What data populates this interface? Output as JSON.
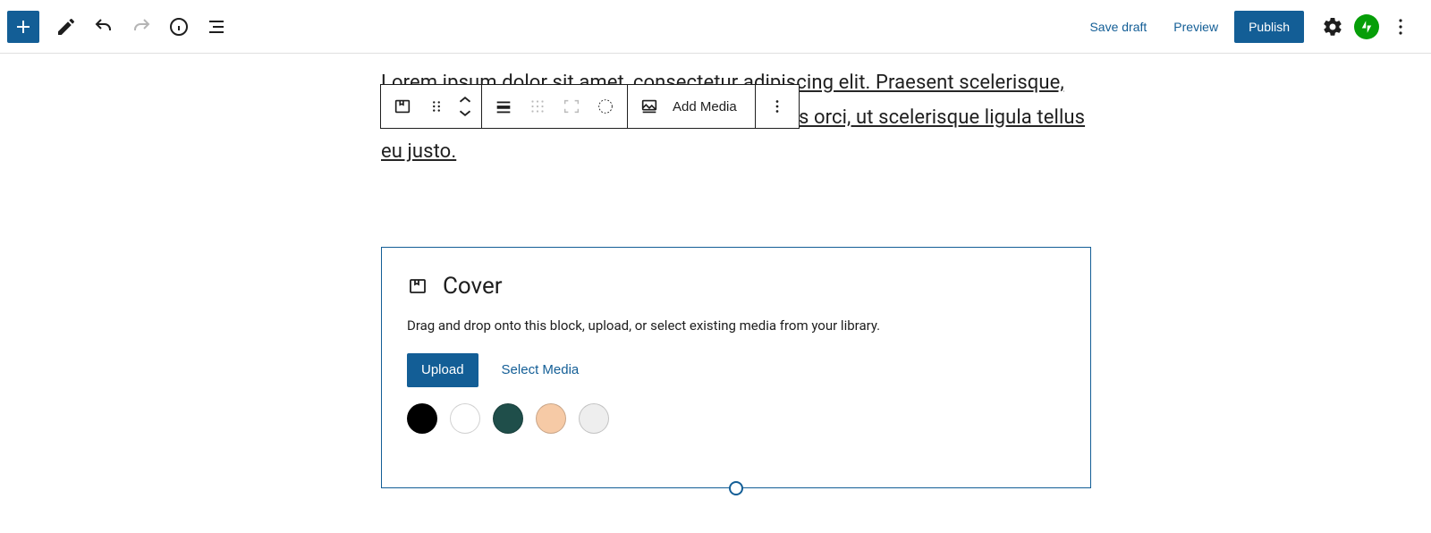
{
  "header": {
    "save_draft": "Save draft",
    "preview": "Preview",
    "publish": "Publish"
  },
  "paragraph": {
    "text": "Lorem ipsum dolor sit amet, consectetur adipiscing elit. Praesent scelerisque, elit venenatis ornare tincidunt, justo urna sagittis orci, ut scelerisque ligula tellus eu justo."
  },
  "block_toolbar": {
    "add_media": "Add Media"
  },
  "cover": {
    "title": "Cover",
    "description": "Drag and drop onto this block, upload, or select existing media from your library.",
    "upload": "Upload",
    "select_media": "Select Media",
    "swatches": [
      "#000000",
      "#ffffff",
      "#1f4e4a",
      "#f6caa6",
      "#eeeeee"
    ]
  }
}
